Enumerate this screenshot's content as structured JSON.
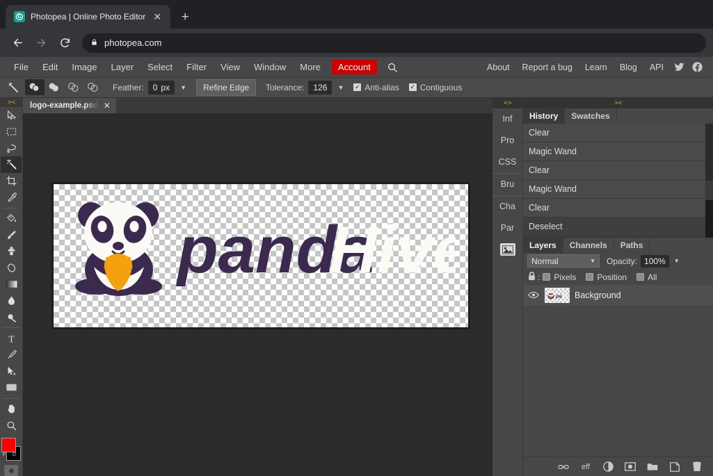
{
  "browser": {
    "tab": {
      "title": "Photopea | Online Photo Editor",
      "favicon": "photopea-spiral-icon",
      "close": "✕"
    },
    "new_tab": "+",
    "nav": {
      "back": "←",
      "forward": "→",
      "reload": "↻"
    },
    "omnibox": {
      "url": "photopea.com",
      "lock": "lock-icon"
    }
  },
  "menubar": {
    "items": [
      "File",
      "Edit",
      "Image",
      "Layer",
      "Select",
      "Filter",
      "View",
      "Window",
      "More"
    ],
    "account": "Account",
    "account_color": "#d10000",
    "search_icon": "search-icon",
    "right_items": [
      "About",
      "Report a bug",
      "Learn",
      "Blog",
      "API"
    ],
    "social": [
      "twitter-icon",
      "facebook-icon"
    ]
  },
  "options_bar": {
    "tool_icon": "magic-wand-icon",
    "selection_modes": [
      "new-selection",
      "add-to-selection",
      "subtract-from-selection",
      "intersect-with-selection"
    ],
    "active_mode_index": 0,
    "feather_label": "Feather:",
    "feather_value": "0",
    "feather_unit": "px",
    "feather_caret": "▼",
    "refine_edge": "Refine Edge",
    "tolerance_label": "Tolerance:",
    "tolerance_value": "126",
    "tolerance_caret": "▼",
    "anti_alias": {
      "label": "Anti-alias",
      "checked": true
    },
    "contiguous": {
      "label": "Contiguous",
      "checked": true
    }
  },
  "tools": {
    "collapse": "> <",
    "items": [
      {
        "name": "move-tool",
        "icon": "cursor-move-icon"
      },
      {
        "name": "rectangular-marquee-tool",
        "icon": "marquee-icon"
      },
      {
        "name": "lasso-tool",
        "icon": "lasso-icon"
      },
      {
        "name": "magic-wand-tool",
        "icon": "magic-wand-icon",
        "active": true
      },
      {
        "name": "crop-tool",
        "icon": "crop-icon"
      },
      {
        "name": "eyedropper-tool",
        "icon": "eyedropper-icon"
      },
      {
        "name": "paint-bucket-tool",
        "icon": "paint-bucket-icon"
      },
      {
        "name": "brush-tool",
        "icon": "brush-icon"
      },
      {
        "name": "clone-stamp-tool",
        "icon": "stamp-icon"
      },
      {
        "name": "eraser-tool",
        "icon": "eraser-icon"
      },
      {
        "name": "gradient-tool",
        "icon": "gradient-icon"
      },
      {
        "name": "blur-tool",
        "icon": "droplet-icon"
      },
      {
        "name": "dodge-tool",
        "icon": "dodge-icon"
      },
      {
        "name": "type-tool",
        "icon": "text-t-icon"
      },
      {
        "name": "pen-tool",
        "icon": "pen-icon"
      },
      {
        "name": "path-selection-tool",
        "icon": "path-arrow-icon"
      },
      {
        "name": "shape-tool",
        "icon": "rectangle-shape-icon"
      },
      {
        "name": "hand-tool",
        "icon": "hand-icon"
      },
      {
        "name": "zoom-tool",
        "icon": "magnifier-icon"
      }
    ],
    "foreground_color": "#ff0000",
    "background_color": "#000000",
    "fg_label": "F",
    "bg_label": "D",
    "quick_mask": "quick-mask-icon"
  },
  "document": {
    "tab_name": "logo-example.psd",
    "tab_close": "✕",
    "logo": {
      "text_primary": "panda",
      "text_secondary": "Hive",
      "mascot": "panda-mascot-icon",
      "dark_color": "#3b2a4d",
      "accent_color": "#f5a00d",
      "light_color": "#fbfaf5"
    }
  },
  "right_sidebar": {
    "collapse": "< >",
    "tabs": [
      "Inf",
      "Pro",
      "CSS",
      "Bru",
      "Cha",
      "Par"
    ],
    "image_tab_icon": "image-icon"
  },
  "panels": {
    "collapse": "> <",
    "top_tabs": [
      {
        "label": "History",
        "active": true
      },
      {
        "label": "Swatches",
        "active": false
      }
    ],
    "history_items": [
      {
        "label": "Clear",
        "current": false
      },
      {
        "label": "Magic Wand",
        "current": false
      },
      {
        "label": "Clear",
        "current": false
      },
      {
        "label": "Magic Wand",
        "current": false
      },
      {
        "label": "Clear",
        "current": false
      },
      {
        "label": "Deselect",
        "current": true
      }
    ],
    "bottom_tabs": [
      {
        "label": "Layers",
        "active": true
      },
      {
        "label": "Channels",
        "active": false
      },
      {
        "label": "Paths",
        "active": false
      }
    ],
    "blend_mode": "Normal",
    "blend_caret": "▼",
    "opacity_label": "Opacity:",
    "opacity_value": "100%",
    "opacity_caret": "▼",
    "lock_icon": "lock-icon",
    "lock_colon": ":",
    "lock_options": [
      {
        "label": "Pixels",
        "checked": false
      },
      {
        "label": "Position",
        "checked": false
      },
      {
        "label": "All",
        "checked": false
      }
    ],
    "layers": [
      {
        "name": "Background",
        "visible": true,
        "thumb": "logo-thumbnail"
      }
    ],
    "footer_icons": [
      {
        "name": "link-layers-icon",
        "glyph": "⚭"
      },
      {
        "name": "layer-effects-icon",
        "glyph": "eff"
      },
      {
        "name": "adjustment-layer-icon",
        "glyph": "half-circle"
      },
      {
        "name": "layer-mask-icon",
        "glyph": "mask"
      },
      {
        "name": "new-group-icon",
        "glyph": "folder"
      },
      {
        "name": "new-layer-icon",
        "glyph": "page"
      },
      {
        "name": "delete-layer-icon",
        "glyph": "trash"
      }
    ]
  }
}
